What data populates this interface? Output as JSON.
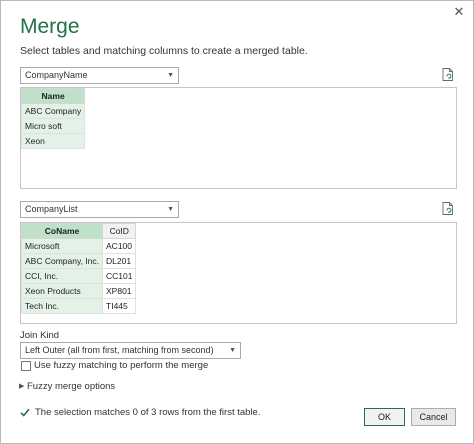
{
  "dialog": {
    "title": "Merge",
    "subtitle": "Select tables and matching columns to create a merged table.",
    "close_glyph": "✕"
  },
  "table1": {
    "selected": "CompanyName",
    "headers": [
      "Name"
    ],
    "rows": [
      [
        "ABC Company"
      ],
      [
        "Micro soft"
      ],
      [
        "Xeon"
      ]
    ]
  },
  "table2": {
    "selected": "CompanyList",
    "headers": [
      "CoName",
      "CoID"
    ],
    "rows": [
      [
        "Microsoft",
        "AC100"
      ],
      [
        "ABC Company, Inc.",
        "DL201"
      ],
      [
        "CCI, Inc.",
        "CC101"
      ],
      [
        "Xeon Products",
        "XP801"
      ],
      [
        "Tech Inc.",
        "TI445"
      ]
    ]
  },
  "join": {
    "label": "Join Kind",
    "selected": "Left Outer (all from first, matching from second)",
    "fuzzy_checkbox_label": "Use fuzzy matching to perform the merge",
    "fuzzy_checked": false,
    "fuzzy_options_label": "Fuzzy merge options"
  },
  "status": {
    "text": "The selection matches 0 of 3 rows from the first table."
  },
  "buttons": {
    "ok": "OK",
    "cancel": "Cancel"
  },
  "colors": {
    "accent": "#217346",
    "selected_column": "#c6e0ce",
    "check": "#217346"
  }
}
